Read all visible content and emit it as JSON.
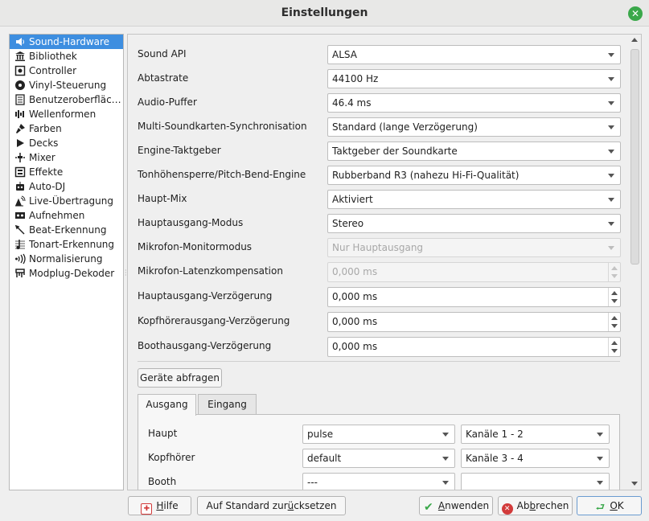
{
  "window": {
    "title": "Einstellungen",
    "close_label": "✕"
  },
  "sidebar": {
    "items": [
      {
        "label": "Sound-Hardware",
        "icon": "speaker-icon"
      },
      {
        "label": "Bibliothek",
        "icon": "library-icon"
      },
      {
        "label": "Controller",
        "icon": "controller-icon"
      },
      {
        "label": "Vinyl-Steuerung",
        "icon": "vinyl-icon"
      },
      {
        "label": "Benutzeroberfläche",
        "icon": "interface-icon"
      },
      {
        "label": "Wellenformen",
        "icon": "waveform-icon"
      },
      {
        "label": "Farben",
        "icon": "paint-icon"
      },
      {
        "label": "Decks",
        "icon": "play-icon"
      },
      {
        "label": "Mixer",
        "icon": "mixer-icon"
      },
      {
        "label": "Effekte",
        "icon": "effects-icon"
      },
      {
        "label": "Auto-DJ",
        "icon": "robot-icon"
      },
      {
        "label": "Live-Übertragung",
        "icon": "broadcast-icon"
      },
      {
        "label": "Aufnehmen",
        "icon": "record-icon"
      },
      {
        "label": "Beat-Erkennung",
        "icon": "beat-icon"
      },
      {
        "label": "Tonart-Erkennung",
        "icon": "key-icon"
      },
      {
        "label": "Normalisierung",
        "icon": "normalize-icon"
      },
      {
        "label": "Modplug-Dekoder",
        "icon": "modplug-icon"
      }
    ]
  },
  "settings": {
    "sound_api": {
      "label": "Sound API",
      "value": "ALSA"
    },
    "sample_rate": {
      "label": "Abtastrate",
      "value": "44100 Hz"
    },
    "audio_buffer": {
      "label": "Audio-Puffer",
      "value": "46.4 ms"
    },
    "multi_sync": {
      "label": "Multi-Soundkarten-Synchronisation",
      "value": "Standard (lange Verzögerung)"
    },
    "engine_clock": {
      "label": "Engine-Taktgeber",
      "value": "Taktgeber der Soundkarte"
    },
    "pitch_engine": {
      "label": "Tonhöhensperre/Pitch-Bend-Engine",
      "value": "Rubberband R3 (nahezu Hi-Fi-Qualität)"
    },
    "main_mix": {
      "label": "Haupt-Mix",
      "value": "Aktiviert"
    },
    "main_output_mode": {
      "label": "Hauptausgang-Modus",
      "value": "Stereo"
    },
    "mic_monitor_mode": {
      "label": "Mikrofon-Monitormodus",
      "value": "Nur Hauptausgang"
    },
    "mic_latency": {
      "label": "Mikrofon-Latenzkompensation",
      "value": "0,000 ms"
    },
    "main_delay": {
      "label": "Hauptausgang-Verzögerung",
      "value": "0,000 ms"
    },
    "headphone_delay": {
      "label": "Kopfhörerausgang-Verzögerung",
      "value": "0,000 ms"
    },
    "booth_delay": {
      "label": "Boothausgang-Verzögerung",
      "value": "0,000 ms"
    }
  },
  "query_devices_label": "Geräte abfragen",
  "tabs": [
    {
      "label": "Ausgang"
    },
    {
      "label": "Eingang"
    }
  ],
  "outputs": [
    {
      "label": "Haupt",
      "device": "pulse",
      "channels": "Kanäle 1 - 2"
    },
    {
      "label": "Kopfhörer",
      "device": "default",
      "channels": "Kanäle 3 - 4"
    },
    {
      "label": "Booth",
      "device": "---",
      "channels": ""
    }
  ],
  "buttons": {
    "help": {
      "pre": "",
      "u": "H",
      "post": "ilfe"
    },
    "reset": {
      "pre": "Auf Standard zur",
      "u": "ü",
      "post": "cksetzen"
    },
    "apply": {
      "pre": "",
      "u": "A",
      "post": "nwenden"
    },
    "cancel": {
      "pre": "Ab",
      "u": "b",
      "post": "rechen"
    },
    "ok": {
      "pre": "",
      "u": "O",
      "post": "K"
    }
  },
  "colors": {
    "selection": "#3d8ee0",
    "accent_green": "#3aa84a",
    "cancel_red": "#d23b3b"
  }
}
